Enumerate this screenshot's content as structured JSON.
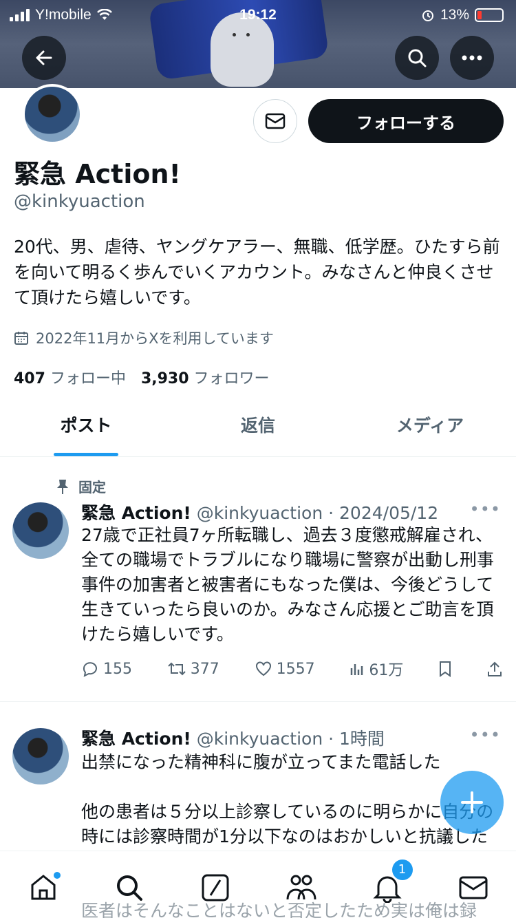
{
  "status_bar": {
    "carrier": "Y!mobile",
    "time": "19:12",
    "battery": "13%"
  },
  "header": {
    "back_label": "←",
    "search_icon": "search-icon",
    "more_icon": "more-icon"
  },
  "profile": {
    "name": "緊急 Action!",
    "handle": "@kinkyuaction",
    "follow_label": "フォローする",
    "bio": "20代、男、虐待、ヤングケアラー、無職、低学歴。ひたすら前を向いて明るく歩んでいくアカウント。みなさんと仲良くさせて頂けたら嬉しいです。",
    "joined": "2022年11月からXを利用しています",
    "following_count": "407",
    "following_label": "フォロー中",
    "followers_count": "3,930",
    "followers_label": "フォロワー"
  },
  "tabs": [
    {
      "label": "ポスト"
    },
    {
      "label": "返信"
    },
    {
      "label": "メディア"
    }
  ],
  "posts": [
    {
      "pinned_label": "固定",
      "name": "緊急 Action!",
      "meta": "@kinkyuaction · 2024/05/12",
      "text": "27歳で正社員7ヶ所転職し、過去３度懲戒解雇され、全ての職場でトラブルになり職場に警察が出動し刑事事件の加害者と被害者にもなった僕は、今後どうして生きていったら良いのか。みなさん応援とご助言を頂けたら嬉しいです。",
      "replies": "155",
      "reposts": "377",
      "likes": "1557",
      "views": "61万"
    },
    {
      "name": "緊急 Action!",
      "meta": "@kinkyuaction · 1時間",
      "line1": "出禁になった精神科に腹が立ってまた電話した",
      "line2": "他の患者は５分以上診察しているのに明らかに自分の時には診察時間が1分以下なのはおかしいと抗議した",
      "line3": "医者はそんなことはないと否定したため実は俺は録"
    }
  ],
  "bottom_nav": {
    "notification_badge": "1"
  }
}
